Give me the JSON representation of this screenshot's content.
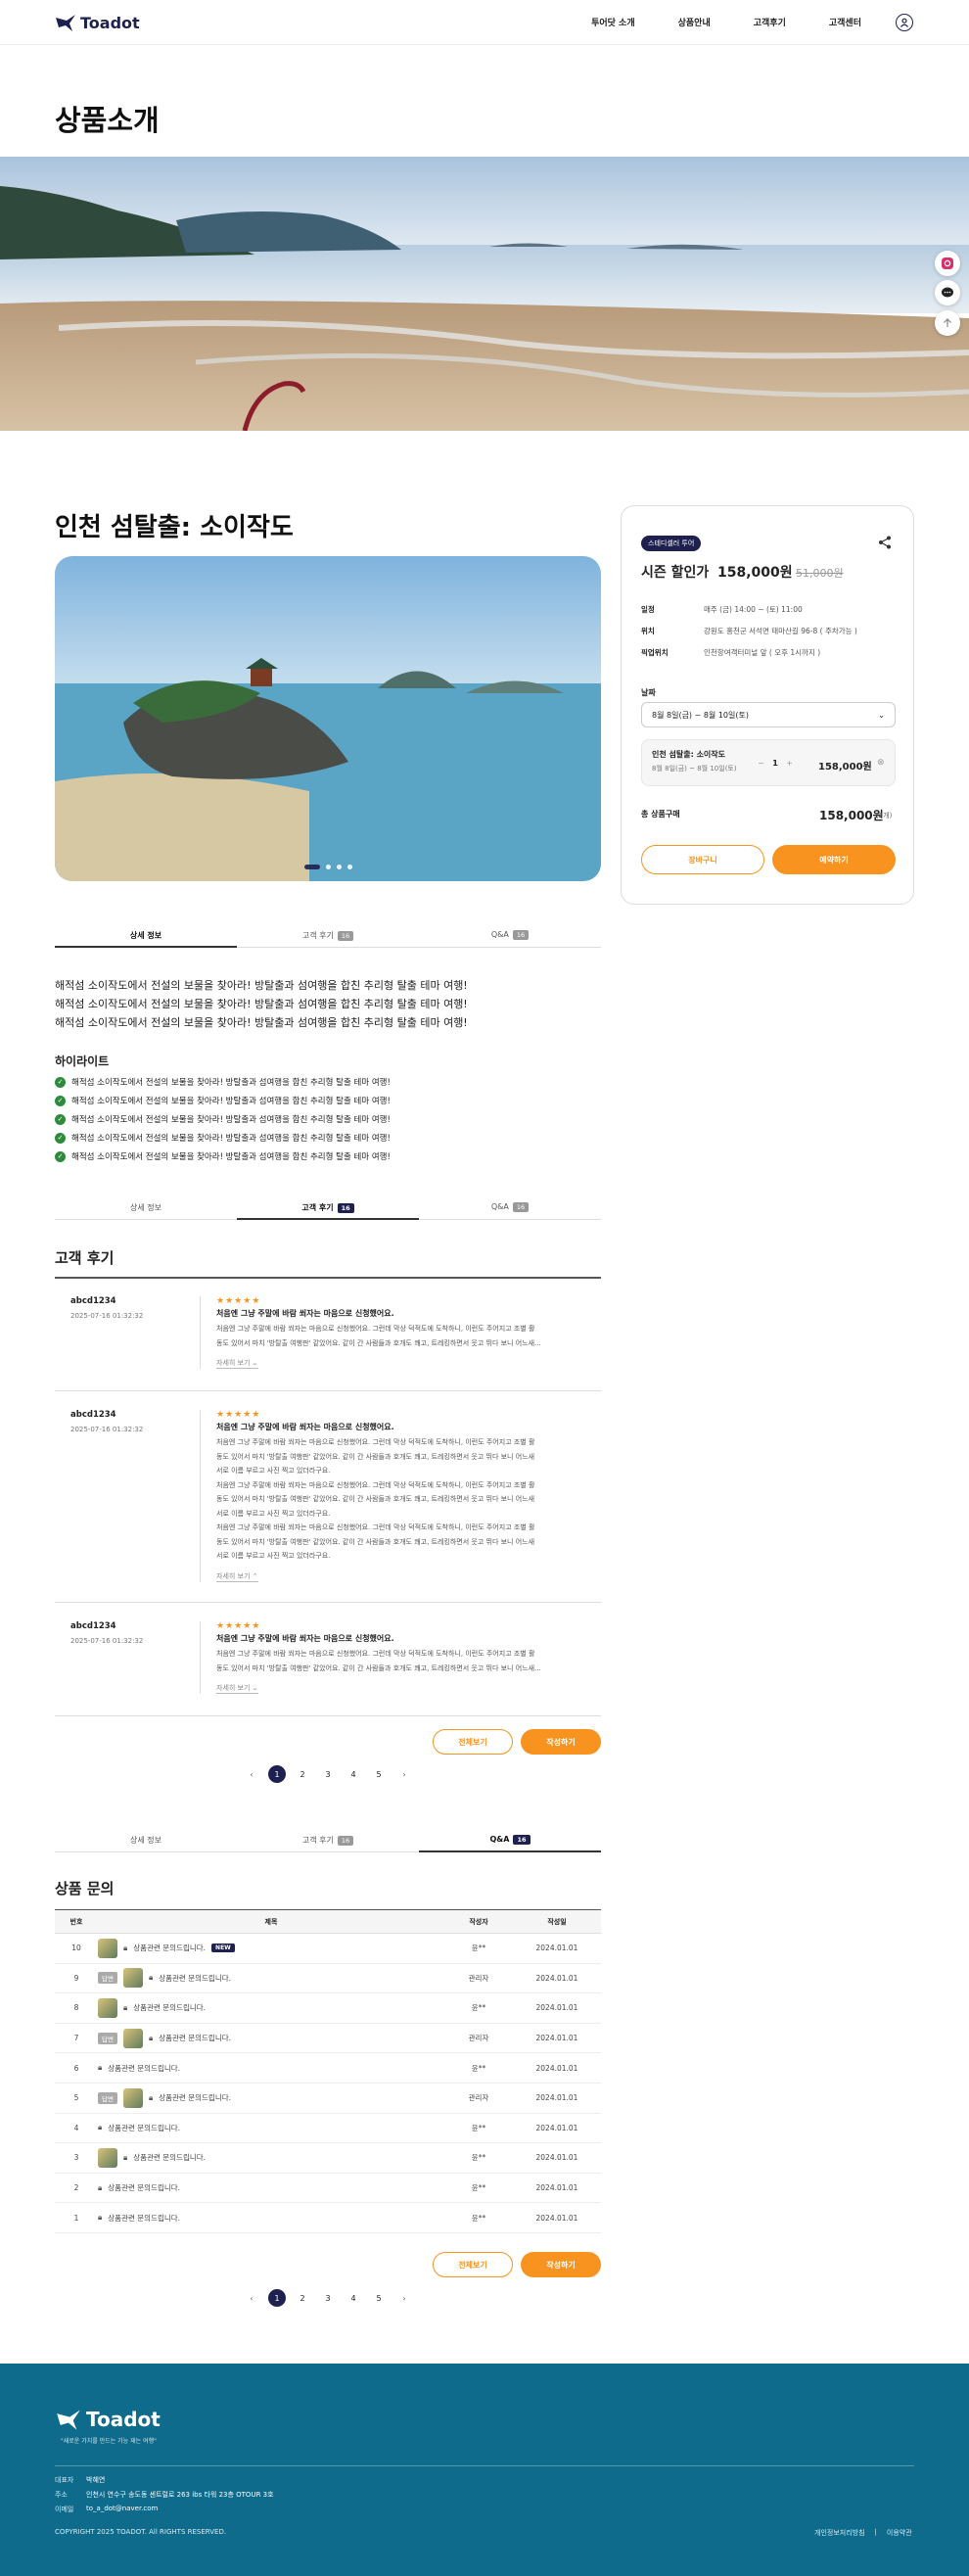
{
  "header": {
    "logo": "Toadot",
    "nav": [
      "투어닷 소개",
      "상품안내",
      "고객후기",
      "고객센터"
    ]
  },
  "page_title": "상품소개",
  "product": {
    "title": "인천 섬탈출: 소이작도",
    "badge": "스테디셀러 투어",
    "price_label": "시즌 할인가",
    "price": "158,000원",
    "price_old": "51,000원",
    "info": [
      {
        "k": "일정",
        "v": "매주 (금) 14:00 ~ (토) 11:00"
      },
      {
        "k": "위치",
        "v": "강원도 홍천군 서석면 태마산길 96-8 ( 주차가능 )"
      },
      {
        "k": "픽업위치",
        "v": "인천항여객터미널 앞 ( 오후 1시까지 )"
      }
    ],
    "date_label": "날짜",
    "date_value": "8월 8일(금) ~ 8월 10일(토)",
    "option": {
      "name": "인천 섬탈출: 소이작도",
      "date": "8월 8일(금) ~ 8월 10일(토)",
      "qty": "1",
      "price": "158,000원"
    },
    "total_label": "총 상품구매",
    "total_value": "158,000원",
    "total_count": "(1개)",
    "cart_btn": "장바구니",
    "book_btn": "예약하기"
  },
  "tabs": {
    "detail": "상세 정보",
    "review": "고객 후기",
    "review_count": "16",
    "qa": "Q&A",
    "qa_count": "16"
  },
  "detail": {
    "lines": [
      "해적섬 소이작도에서 전설의 보물을 찾아라! 방탈출과 섬여행을 합친 추리형 탈출 테마 여행!",
      "해적섬 소이작도에서 전설의 보물을 찾아라! 방탈출과 섬여행을 합친 추리형 탈출 테마 여행!",
      "해적섬 소이작도에서 전설의 보물을 찾아라! 방탈출과 섬여행을 합친 추리형 탈출 테마 여행!"
    ],
    "highlight_title": "하이라이트",
    "highlights": [
      "해적섬 소이작도에서 전설의 보물을 찾아라! 방탈출과 섬여행을 합친 추리형 탈출 테마 여행!",
      "해적섬 소이작도에서 전설의 보물을 찾아라! 방탈출과 섬여행을 합친 추리형 탈출 테마 여행!",
      "해적섬 소이작도에서 전설의 보물을 찾아라! 방탈출과 섬여행을 합친 추리형 탈출 테마 여행!",
      "해적섬 소이작도에서 전설의 보물을 찾아라! 방탈출과 섬여행을 합친 추리형 탈출 테마 여행!",
      "해적섬 소이작도에서 전설의 보물을 찾아라! 방탈출과 섬여행을 합친 추리형 탈출 테마 여행!"
    ]
  },
  "reviews": {
    "title": "고객 후기",
    "items": [
      {
        "user": "abcd1234",
        "date": "2025-07-16 01:32:32",
        "stars": "★★★★★",
        "head": "처음엔 그냥 주말에 바람 쐬자는 마음으로 신청했어요.",
        "lines": [
          "처음엔 그냥 주말에 바람 쐬자는 마음으로 신청했어요. 그런데 막상 덕적도에 도착하니, 이런도 주어지고 조별 활",
          "동도 있어서 마치 '방탈출 여행판' 같았어요. 같이 간 사람들과 호개도 쾌고, 트레킹하면서 웃고 뛰다 보니 어느새..."
        ],
        "more": "자세히 보기 ⌄"
      },
      {
        "user": "abcd1234",
        "date": "2025-07-16 01:32:32",
        "stars": "★★★★★",
        "head": "처음엔 그냥 주말에 바람 쐬자는 마음으로 신청했어요.",
        "lines": [
          "처음엔 그냥 주말에 바람 쐬자는 마음으로 신청했어요. 그런데 막상 덕적도에 도착하니, 이런도 주어지고 조별 활",
          "동도 있어서 마치 '방탈출 여행판' 같았어요. 같이 간 사람들과 호개도 쾌고, 트레킹하면서 웃고 뛰다 보니 어느새",
          "서로 이름 부르고 사진 찍고 있더라구요.",
          "처음엔 그냥 주말에 바람 쐬자는 마음으로 신청했어요. 그런데 막상 덕적도에 도착하니, 이런도 주어지고 조별 활",
          "동도 있어서 마치 '방탈출 여행판' 같았어요. 같이 간 사람들과 호개도 쾌고, 트레킹하면서 웃고 뛰다 보니 어느새",
          "서로 이름 부르고 사진 찍고 있더라구요.",
          "처음엔 그냥 주말에 바람 쐬자는 마음으로 신청했어요. 그런데 막상 덕적도에 도착하니, 이런도 주어지고 조별 활",
          "동도 있어서 마치 '방탈출 여행판' 같았어요. 같이 간 사람들과 호개도 쾌고, 트레킹하면서 웃고 뛰다 보니 어느새",
          "서로 이름 부르고 사진 찍고 있더라구요."
        ],
        "more": "자세히 보기 ⌃"
      },
      {
        "user": "abcd1234",
        "date": "2025-07-16 01:32:32",
        "stars": "★★★★★",
        "head": "처음엔 그냥 주말에 바람 쐬자는 마음으로 신청했어요.",
        "lines": [
          "처음엔 그냥 주말에 바람 쐬자는 마음으로 신청했어요. 그런데 막상 덕적도에 도착하니, 이런도 주어지고 조별 활",
          "동도 있어서 마치 '방탈출 여행판' 같았어요. 같이 간 사람들과 호개도 쾌고, 트레킹하면서 웃고 뛰다 보니 어느새..."
        ],
        "more": "자세히 보기 ⌄"
      }
    ],
    "all_btn": "전체보기",
    "write_btn": "작성하기"
  },
  "pager": [
    "1",
    "2",
    "3",
    "4",
    "5"
  ],
  "qa": {
    "title": "상품 문의",
    "headers": [
      "번호",
      "제목",
      "작성자",
      "작성일"
    ],
    "rows": [
      {
        "no": "10",
        "reply": false,
        "thumb": true,
        "title": "상품관련 문의드립니다.",
        "new": "NEW",
        "writer": "윤**",
        "date": "2024.01.01"
      },
      {
        "no": "9",
        "reply": true,
        "thumb": true,
        "title": "상품관련 문의드립니다.",
        "new": "",
        "writer": "관리자",
        "date": "2024.01.01"
      },
      {
        "no": "8",
        "reply": false,
        "thumb": true,
        "title": "상품관련 문의드립니다.",
        "new": "",
        "writer": "윤**",
        "date": "2024.01.01"
      },
      {
        "no": "7",
        "reply": true,
        "thumb": true,
        "title": "상품관련 문의드립니다.",
        "new": "",
        "writer": "관리자",
        "date": "2024.01.01"
      },
      {
        "no": "6",
        "reply": false,
        "thumb": false,
        "title": "상품관련 문의드립니다.",
        "new": "",
        "writer": "윤**",
        "date": "2024.01.01"
      },
      {
        "no": "5",
        "reply": true,
        "thumb": true,
        "title": "상품관련 문의드립니다.",
        "new": "",
        "writer": "관리자",
        "date": "2024.01.01"
      },
      {
        "no": "4",
        "reply": false,
        "thumb": false,
        "title": "상품관련 문의드립니다.",
        "new": "",
        "writer": "윤**",
        "date": "2024.01.01"
      },
      {
        "no": "3",
        "reply": false,
        "thumb": true,
        "title": "상품관련 문의드립니다.",
        "new": "",
        "writer": "윤**",
        "date": "2024.01.01"
      },
      {
        "no": "2",
        "reply": false,
        "thumb": false,
        "title": "상품관련 문의드립니다.",
        "new": "",
        "writer": "윤**",
        "date": "2024.01.01"
      },
      {
        "no": "1",
        "reply": false,
        "thumb": false,
        "title": "상품관련 문의드립니다.",
        "new": "",
        "writer": "윤**",
        "date": "2024.01.01"
      }
    ],
    "reply_label": "답변",
    "all_btn": "전체보기",
    "write_btn": "작성하기"
  },
  "footer": {
    "logo": "Toadot",
    "slogan": "\"새로운 가치를 만드는 가능 재는 여행\"",
    "rows": [
      {
        "k": "대표자",
        "v": "박혜연"
      },
      {
        "k": "주소",
        "v": "인천시 연수구 송도동 센트럴로 263 ibs 타워 23층 OTOUR 3호"
      },
      {
        "k": "이메일",
        "v": "to_a_dot@naver.com"
      }
    ],
    "copyright": "COPYRIGHT 2025 TOADOT. All RIGHTS RESERVED.",
    "links": [
      "개인정보처리방침",
      "|",
      "이용약관"
    ]
  },
  "colors": {
    "navy": "#1e2150",
    "orange": "#f7931e",
    "footer": "#0e6b8c"
  }
}
